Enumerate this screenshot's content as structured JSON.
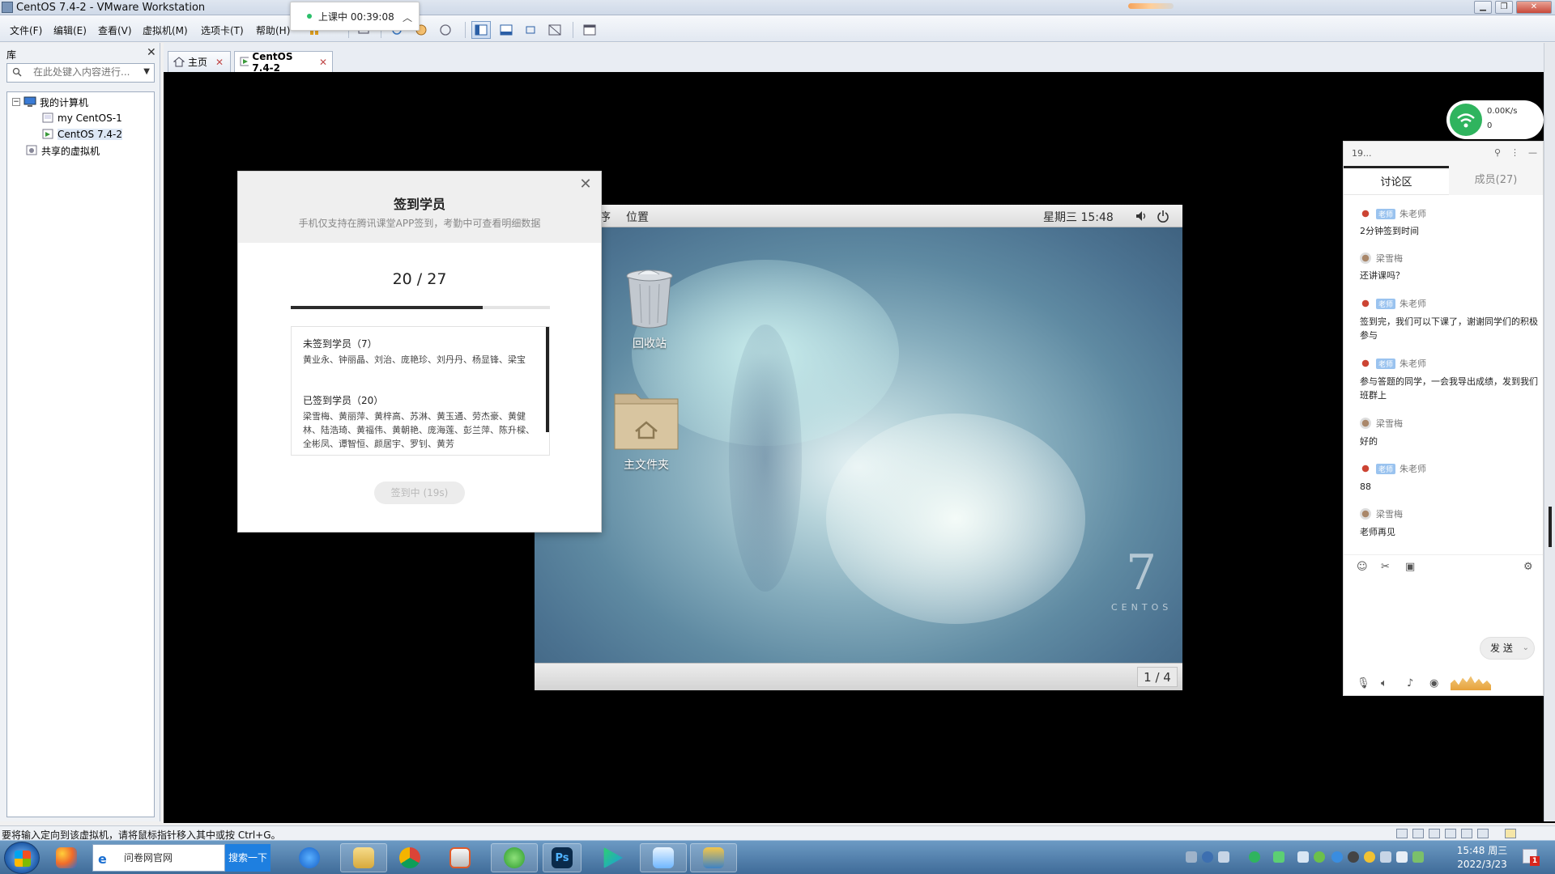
{
  "window": {
    "title": "CentOS 7.4-2 - VMware Workstation"
  },
  "menu": [
    "文件(F)",
    "编辑(E)",
    "查看(V)",
    "虚拟机(M)",
    "选项卡(T)",
    "帮助(H)"
  ],
  "live_pill": {
    "text": "上课中 00:39:08"
  },
  "library": {
    "header": "库",
    "search_placeholder": "在此处键入内容进行...",
    "tree": {
      "root": "我的计算机",
      "children": [
        "my CentOS-1",
        "CentOS 7.4-2"
      ],
      "shared": "共享的虚拟机"
    }
  },
  "tabs": [
    {
      "label": "主页"
    },
    {
      "label": "CentOS 7.4-2"
    }
  ],
  "guest": {
    "topbar_places": "位置",
    "topbar_partial": "序",
    "clock": "星期三 15:48",
    "icons": [
      {
        "label": "回收站"
      },
      {
        "label": "主文件夹"
      }
    ],
    "brand_number": "7",
    "brand_text": "CENTOS",
    "pager": "1 / 4"
  },
  "signin_dialog": {
    "title": "签到学员",
    "subtitle": "手机仅支持在腾讯课堂APP签到，考勤中可查看明细数据",
    "count_text": "20 / 27",
    "signed_fraction": 0.74,
    "unsigned_header": "未签到学员（7）",
    "unsigned_names": "黄业永、钟丽晶、刘治、庞艳珍、刘丹丹、杨显锋、梁宝",
    "signed_header": "已签到学员（20）",
    "signed_names": "梁雪梅、黄丽萍、黄梓高、苏淋、黄玉通、劳杰豪、黄健林、陆浩琦、黄福伟、黄朝艳、庞海莲、彭兰萍、陈升樑、全彬凤、谭智恒、颜居宇、罗钊、黄芳",
    "button": "签到中 (19s)"
  },
  "net_widget": {
    "speed": "0.00K/s",
    "count": "0"
  },
  "chat": {
    "header": "19...",
    "tabs": [
      "讨论区",
      "成员(27)"
    ],
    "teacher_badge": "老师",
    "messages": [
      {
        "user": "朱老师",
        "teacher": true,
        "text": "2分钟签到时间"
      },
      {
        "user": "梁雪梅",
        "teacher": false,
        "text": "还讲课吗？"
      },
      {
        "user": "朱老师",
        "teacher": true,
        "text": "签到完，我们可以下课了，谢谢同学们的积极参与"
      },
      {
        "user": "朱老师",
        "teacher": true,
        "text": "参与答题的同学，一会我导出成绩，发到我们班群上"
      },
      {
        "user": "梁雪梅",
        "teacher": false,
        "text": "好的"
      },
      {
        "user": "朱老师",
        "teacher": true,
        "text": "88"
      },
      {
        "user": "梁雪梅",
        "teacher": false,
        "text": "老师再见"
      }
    ],
    "send": "发 送"
  },
  "statusbar": {
    "message": "要将输入定向到该虚拟机，请将鼠标指针移入其中或按 Ctrl+G。"
  },
  "taskbar": {
    "search_value": "问卷网官网",
    "search_button": "搜索一下",
    "clock_time": "15:48 周三",
    "clock_date": "2022/3/23",
    "notif_count": "1"
  }
}
